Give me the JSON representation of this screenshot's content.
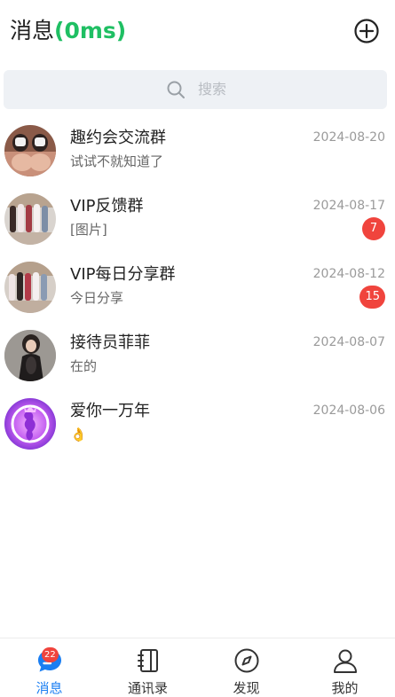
{
  "header": {
    "title": "消息",
    "latency": "(0ms)"
  },
  "search": {
    "placeholder": "搜索"
  },
  "conversations": [
    {
      "name": "趣约会交流群",
      "preview": "试试不就知道了",
      "date": "2024-08-20",
      "badge": ""
    },
    {
      "name": "VIP反馈群",
      "preview": "[图片]",
      "date": "2024-08-17",
      "badge": "7"
    },
    {
      "name": "VIP每日分享群",
      "preview": "今日分享",
      "date": "2024-08-12",
      "badge": "15"
    },
    {
      "name": "接待员菲菲",
      "preview": "在的",
      "date": "2024-08-07",
      "badge": ""
    },
    {
      "name": "爱你一万年",
      "preview": "👌",
      "date": "2024-08-06",
      "badge": ""
    }
  ],
  "tabs": [
    {
      "label": "消息",
      "icon": "chat-bubble-icon",
      "badge": "22"
    },
    {
      "label": "通讯录",
      "icon": "contacts-book-icon"
    },
    {
      "label": "发现",
      "icon": "compass-icon"
    },
    {
      "label": "我的",
      "icon": "user-icon"
    }
  ],
  "colors": {
    "accent": "#1a7ef2",
    "latency": "#1fbf63",
    "badge": "#f0443d"
  }
}
